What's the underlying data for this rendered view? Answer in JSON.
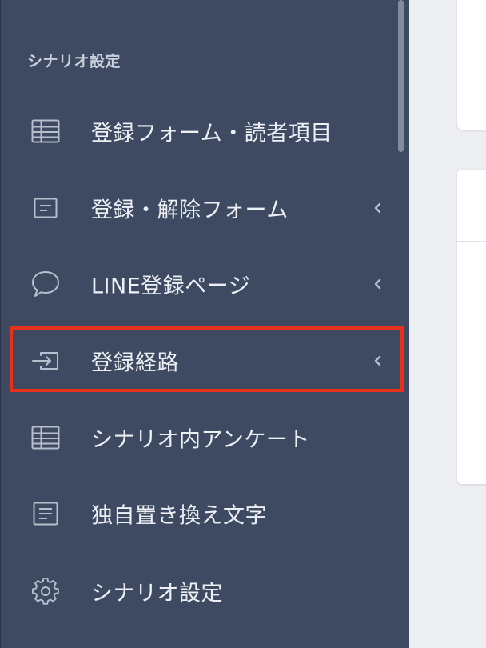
{
  "sidebar": {
    "section_title": "シナリオ設定",
    "items": [
      {
        "label": "登録フォーム・読者項目",
        "icon": "table-icon",
        "has_chevron": false
      },
      {
        "label": "登録・解除フォーム",
        "icon": "form-icon",
        "has_chevron": true
      },
      {
        "label": "LINE登録ページ",
        "icon": "chat-bubble-icon",
        "has_chevron": true
      },
      {
        "label": "登録経路",
        "icon": "entry-arrow-icon",
        "has_chevron": true,
        "highlighted": true
      },
      {
        "label": "シナリオ内アンケート",
        "icon": "table-icon",
        "has_chevron": false
      },
      {
        "label": "独自置き換え文字",
        "icon": "document-icon",
        "has_chevron": false
      },
      {
        "label": "シナリオ設定",
        "icon": "gear-icon",
        "has_chevron": false
      }
    ]
  },
  "colors": {
    "sidebar_bg": "#3e4a61",
    "highlight_border": "#e8311a",
    "content_bg": "#eceef1"
  }
}
